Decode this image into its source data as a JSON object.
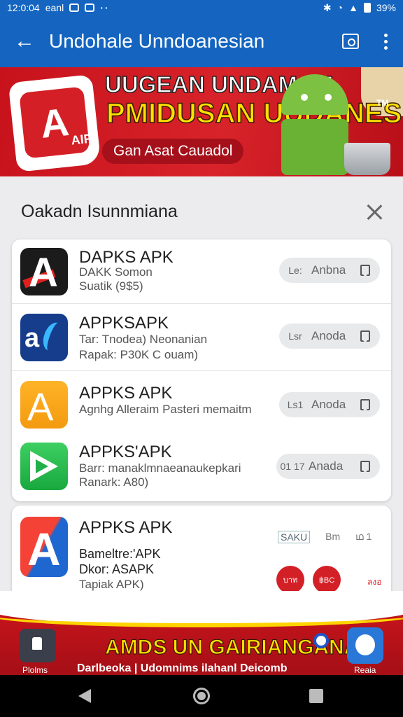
{
  "status_bar": {
    "time": "12:0:04",
    "carrier": "eanl",
    "battery": "39%"
  },
  "app_bar": {
    "title": "Undohale Unndoanesian"
  },
  "banner": {
    "line1": "UUGEAN UNDAMAM",
    "line2": "PMIDUSAN UUDANESIA",
    "tm": "TM",
    "cta": "Gan Asat Cauadol",
    "logo_text": "AIF"
  },
  "dialog": {
    "title": "Oakadn Isunnmiana"
  },
  "apps": [
    {
      "name": "DAPKS APK",
      "sub1": "DAKK Somon",
      "sub2": "Suatik (9$5)",
      "num": "Le:",
      "action": "Anbna",
      "icon": "a-red-icon"
    },
    {
      "name": "APPKSAPK",
      "sub1": "Tar: Tnodea) Neonanian",
      "sub2": "Rapak: P30K C ouam)",
      "num": "Lsr",
      "action": "Anoda",
      "icon": "ax-blue-icon"
    },
    {
      "name": "APPKS APK",
      "sub1": "Agnhg Alleraim Pasteri memaitm",
      "sub2": "",
      "num": "Ls1",
      "action": "Anoda",
      "icon": "a-orange-icon"
    },
    {
      "name": "APPKS'APK",
      "sub1": "Barr: manaklmnaeanaukepkari",
      "sub2": "Ranark: A80)",
      "num": "01 17",
      "action": "Anada",
      "icon": "play-green-icon"
    }
  ],
  "featured": {
    "name": "APPKS APK",
    "sub1": "Bameltre:'APK",
    "sub2": "Dkor: ASAPK",
    "sub3": "Tapiak APK)",
    "tag1": "SAKU",
    "tag2": "Bm",
    "tag3": "ഥ 1",
    "btn1": "บาท",
    "btn2": "฿BC",
    "btn3": "ลงอ"
  },
  "promo": {
    "headline": "AMDS UN GAIRIANGANA",
    "sub": "Darlbeoka | Udomnims ilahanl Deicomb",
    "left_label": "Plolms",
    "right_label": "Reaia"
  }
}
